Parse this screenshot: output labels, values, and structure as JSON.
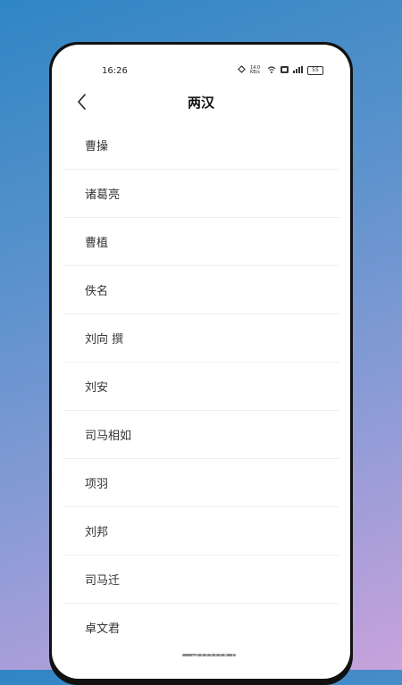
{
  "status_bar": {
    "time": "16:26",
    "speed": "14.0 KB/s",
    "battery": "55"
  },
  "nav": {
    "title": "两汉"
  },
  "list": [
    {
      "label": "曹操"
    },
    {
      "label": "诸葛亮"
    },
    {
      "label": "曹植"
    },
    {
      "label": "佚名"
    },
    {
      "label": "刘向 撰"
    },
    {
      "label": "刘安"
    },
    {
      "label": "司马相如"
    },
    {
      "label": "项羽"
    },
    {
      "label": "刘邦"
    },
    {
      "label": "司马迁"
    },
    {
      "label": "卓文君"
    }
  ],
  "watermark": "新意手游 · SIXINYI.COM"
}
